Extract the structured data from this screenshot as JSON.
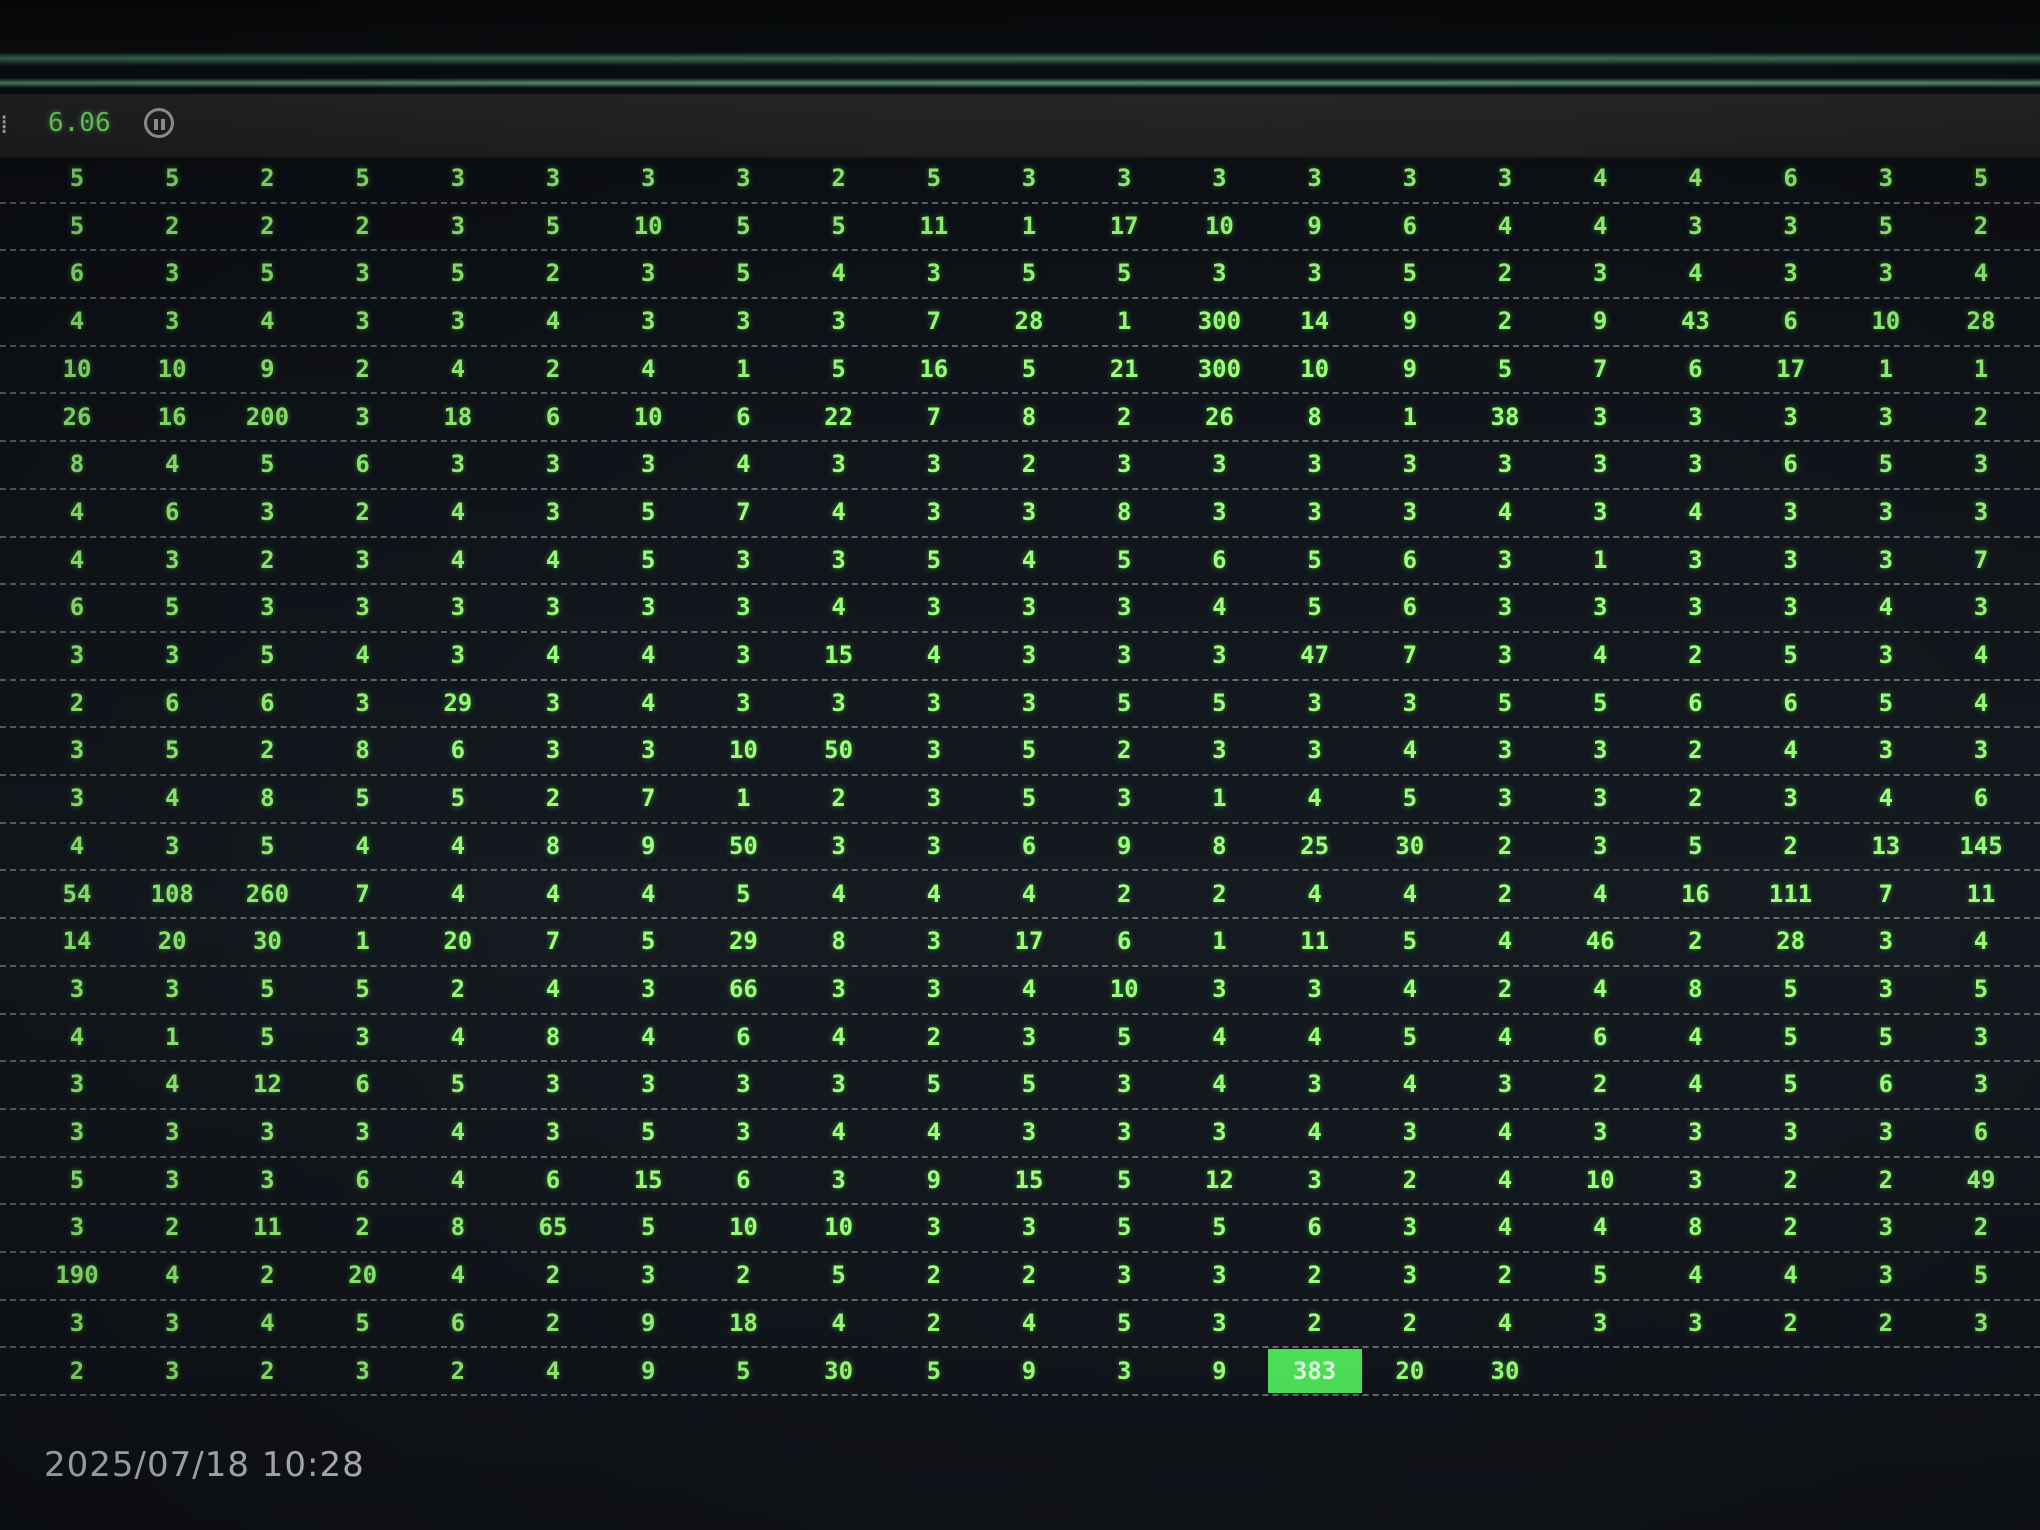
{
  "toolbar": {
    "value": "6.06",
    "pause_icon": "pause-circle-icon",
    "glyph": "⁞"
  },
  "grid": {
    "rows": [
      [
        "5",
        "5",
        "2",
        "5",
        "3",
        "3",
        "3",
        "3",
        "2",
        "5",
        "3",
        "3",
        "3",
        "3",
        "3",
        "3",
        "4",
        "4",
        "6",
        "3",
        "5"
      ],
      [
        "5",
        "2",
        "2",
        "2",
        "3",
        "5",
        "10",
        "5",
        "5",
        "11",
        "1",
        "17",
        "10",
        "9",
        "6",
        "4",
        "4",
        "3",
        "3",
        "5",
        "2"
      ],
      [
        "6",
        "3",
        "5",
        "3",
        "5",
        "2",
        "3",
        "5",
        "4",
        "3",
        "5",
        "5",
        "3",
        "3",
        "5",
        "2",
        "3",
        "4",
        "3",
        "3",
        "4"
      ],
      [
        "4",
        "3",
        "4",
        "3",
        "3",
        "4",
        "3",
        "3",
        "3",
        "7",
        "28",
        "1",
        "300",
        "14",
        "9",
        "2",
        "9",
        "43",
        "6",
        "10",
        "28"
      ],
      [
        "10",
        "10",
        "9",
        "2",
        "4",
        "2",
        "4",
        "1",
        "5",
        "16",
        "5",
        "21",
        "300",
        "10",
        "9",
        "5",
        "7",
        "6",
        "17",
        "1",
        "1"
      ],
      [
        "26",
        "16",
        "200",
        "3",
        "18",
        "6",
        "10",
        "6",
        "22",
        "7",
        "8",
        "2",
        "26",
        "8",
        "1",
        "38",
        "3",
        "3",
        "3",
        "3",
        "2"
      ],
      [
        "8",
        "4",
        "5",
        "6",
        "3",
        "3",
        "3",
        "4",
        "3",
        "3",
        "2",
        "3",
        "3",
        "3",
        "3",
        "3",
        "3",
        "3",
        "6",
        "5",
        "3"
      ],
      [
        "4",
        "6",
        "3",
        "2",
        "4",
        "3",
        "5",
        "7",
        "4",
        "3",
        "3",
        "8",
        "3",
        "3",
        "3",
        "4",
        "3",
        "4",
        "3",
        "3",
        "3"
      ],
      [
        "4",
        "3",
        "2",
        "3",
        "4",
        "4",
        "5",
        "3",
        "3",
        "5",
        "4",
        "5",
        "6",
        "5",
        "6",
        "3",
        "1",
        "3",
        "3",
        "3",
        "7"
      ],
      [
        "6",
        "5",
        "3",
        "3",
        "3",
        "3",
        "3",
        "3",
        "4",
        "3",
        "3",
        "3",
        "4",
        "5",
        "6",
        "3",
        "3",
        "3",
        "3",
        "4",
        "3"
      ],
      [
        "3",
        "3",
        "5",
        "4",
        "3",
        "4",
        "4",
        "3",
        "15",
        "4",
        "3",
        "3",
        "3",
        "47",
        "7",
        "3",
        "4",
        "2",
        "5",
        "3",
        "4"
      ],
      [
        "2",
        "6",
        "6",
        "3",
        "29",
        "3",
        "4",
        "3",
        "3",
        "3",
        "3",
        "5",
        "5",
        "3",
        "3",
        "5",
        "5",
        "6",
        "6",
        "5",
        "4"
      ],
      [
        "3",
        "5",
        "2",
        "8",
        "6",
        "3",
        "3",
        "10",
        "50",
        "3",
        "5",
        "2",
        "3",
        "3",
        "4",
        "3",
        "3",
        "2",
        "4",
        "3",
        "3"
      ],
      [
        "3",
        "4",
        "8",
        "5",
        "5",
        "2",
        "7",
        "1",
        "2",
        "3",
        "5",
        "3",
        "1",
        "4",
        "5",
        "3",
        "3",
        "2",
        "3",
        "4",
        "6"
      ],
      [
        "4",
        "3",
        "5",
        "4",
        "4",
        "8",
        "9",
        "50",
        "3",
        "3",
        "6",
        "9",
        "8",
        "25",
        "30",
        "2",
        "3",
        "5",
        "2",
        "13",
        "145"
      ],
      [
        "54",
        "108",
        "260",
        "7",
        "4",
        "4",
        "4",
        "5",
        "4",
        "4",
        "4",
        "2",
        "2",
        "4",
        "4",
        "2",
        "4",
        "16",
        "111",
        "7",
        "11"
      ],
      [
        "14",
        "20",
        "30",
        "1",
        "20",
        "7",
        "5",
        "29",
        "8",
        "3",
        "17",
        "6",
        "1",
        "11",
        "5",
        "4",
        "46",
        "2",
        "28",
        "3",
        "4"
      ],
      [
        "3",
        "3",
        "5",
        "5",
        "2",
        "4",
        "3",
        "66",
        "3",
        "3",
        "4",
        "10",
        "3",
        "3",
        "4",
        "2",
        "4",
        "8",
        "5",
        "3",
        "5"
      ],
      [
        "4",
        "1",
        "5",
        "3",
        "4",
        "8",
        "4",
        "6",
        "4",
        "2",
        "3",
        "5",
        "4",
        "4",
        "5",
        "4",
        "6",
        "4",
        "5",
        "5",
        "3"
      ],
      [
        "3",
        "4",
        "12",
        "6",
        "5",
        "3",
        "3",
        "3",
        "3",
        "5",
        "5",
        "3",
        "4",
        "3",
        "4",
        "3",
        "2",
        "4",
        "5",
        "6",
        "3"
      ],
      [
        "3",
        "3",
        "3",
        "3",
        "4",
        "3",
        "5",
        "3",
        "4",
        "4",
        "3",
        "3",
        "3",
        "4",
        "3",
        "4",
        "3",
        "3",
        "3",
        "3",
        "6"
      ],
      [
        "5",
        "3",
        "3",
        "6",
        "4",
        "6",
        "15",
        "6",
        "3",
        "9",
        "15",
        "5",
        "12",
        "3",
        "2",
        "4",
        "10",
        "3",
        "2",
        "2",
        "49"
      ],
      [
        "3",
        "2",
        "11",
        "2",
        "8",
        "65",
        "5",
        "10",
        "10",
        "3",
        "3",
        "5",
        "5",
        "6",
        "3",
        "4",
        "4",
        "8",
        "2",
        "3",
        "2"
      ],
      [
        "190",
        "4",
        "2",
        "20",
        "4",
        "2",
        "3",
        "2",
        "5",
        "2",
        "2",
        "3",
        "3",
        "2",
        "3",
        "2",
        "5",
        "4",
        "4",
        "3",
        "5"
      ],
      [
        "3",
        "3",
        "4",
        "5",
        "6",
        "2",
        "9",
        "18",
        "4",
        "2",
        "4",
        "5",
        "3",
        "2",
        "2",
        "4",
        "3",
        "3",
        "2",
        "2",
        "3"
      ],
      [
        "2",
        "3",
        "2",
        "3",
        "2",
        "4",
        "9",
        "5",
        "30",
        "5",
        "9",
        "3",
        "9",
        "383",
        "20",
        "30"
      ]
    ],
    "highlighted": {
      "row": 25,
      "col": 13
    }
  },
  "timestamp": "2025/07/18 10:28"
}
